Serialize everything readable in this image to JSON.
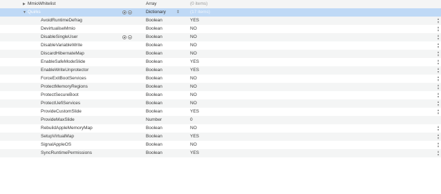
{
  "rows": [
    {
      "key": "MmioWhitelist",
      "type": "Array",
      "value": "(0 items)",
      "disclosure": "▶"
    },
    {
      "key": "Quirks",
      "type": "Dictionary",
      "value": "(17 items)",
      "disclosure": "▼",
      "selected": true
    },
    {
      "key": "AvoidRuntimeDefrag",
      "type": "Boolean",
      "value": "YES"
    },
    {
      "key": "DevirtualiseMmio",
      "type": "Boolean",
      "value": "NO"
    },
    {
      "key": "DisableSingleUser",
      "type": "Boolean",
      "value": "NO"
    },
    {
      "key": "DisableVariableWrite",
      "type": "Boolean",
      "value": "NO"
    },
    {
      "key": "DiscardHibernateMap",
      "type": "Boolean",
      "value": "NO"
    },
    {
      "key": "EnableSafeModeSlide",
      "type": "Boolean",
      "value": "YES"
    },
    {
      "key": "EnableWriteUnprotector",
      "type": "Boolean",
      "value": "YES"
    },
    {
      "key": "ForceExitBootServices",
      "type": "Boolean",
      "value": "NO"
    },
    {
      "key": "ProtectMemoryRegions",
      "type": "Boolean",
      "value": "NO"
    },
    {
      "key": "ProtectSecureBoot",
      "type": "Boolean",
      "value": "NO"
    },
    {
      "key": "ProtectUefiServices",
      "type": "Boolean",
      "value": "NO"
    },
    {
      "key": "ProvideCustomSlide",
      "type": "Boolean",
      "value": "YES"
    },
    {
      "key": "ProvideMaxSlide",
      "type": "Number",
      "value": "0"
    },
    {
      "key": "RebuildAppleMemoryMap",
      "type": "Boolean",
      "value": "NO"
    },
    {
      "key": "SetupVirtualMap",
      "type": "Boolean",
      "value": "YES"
    },
    {
      "key": "SignalAppleOS",
      "type": "Boolean",
      "value": "NO"
    },
    {
      "key": "SyncRuntimePermissions",
      "type": "Boolean",
      "value": "YES"
    }
  ],
  "colors": {
    "selected_row": "#bfd9f6",
    "stripe": "#f4f5f5",
    "text": "#3a3a3a"
  },
  "icons": {
    "disclosure_open": "triangle-down-icon",
    "disclosure_closed": "triangle-right-icon",
    "add": "add-row-icon",
    "remove": "remove-row-icon",
    "value_stepper": "up-down-stepper-icon"
  }
}
